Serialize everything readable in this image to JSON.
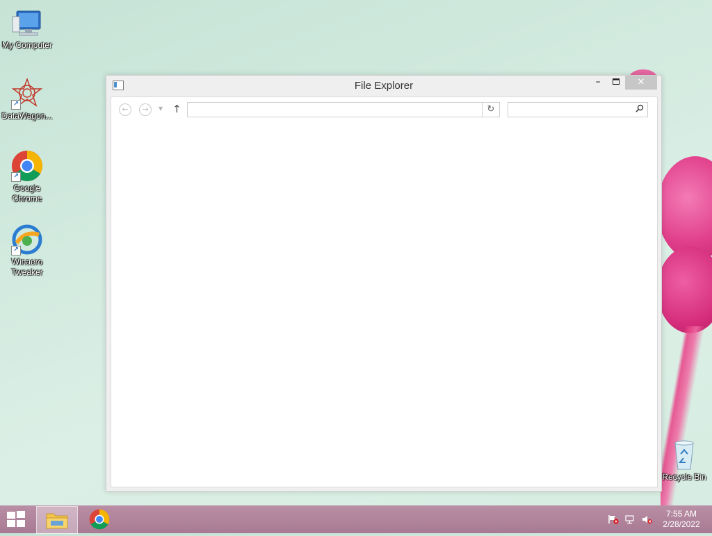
{
  "desktop": {
    "icons": [
      {
        "label": "My Computer"
      },
      {
        "label": "DataWagon..."
      },
      {
        "label": "Google Chrome"
      },
      {
        "label": "Winaero Tweaker"
      },
      {
        "label": "Recycle Bin"
      }
    ]
  },
  "window": {
    "title": "File Explorer",
    "minimize_symbol": "–",
    "maximize_symbol": "■",
    "close_symbol": "✕",
    "address_value": "",
    "search_placeholder": ""
  },
  "taskbar": {
    "time": "7:55 AM",
    "date": "2/28/2022"
  },
  "colors": {
    "accent_pink": "#e03d89",
    "taskbar": "#b08299"
  }
}
